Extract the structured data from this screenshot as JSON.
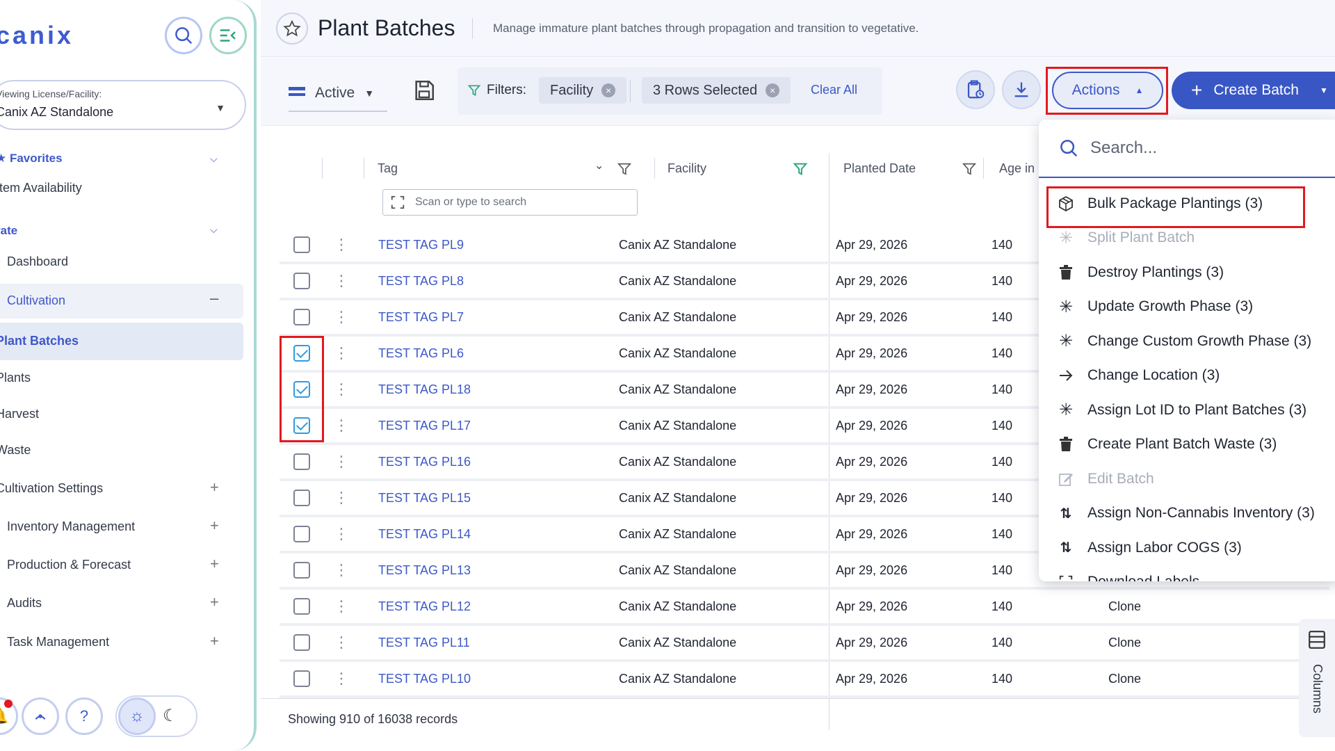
{
  "app": {
    "brand": "canix"
  },
  "sidebar": {
    "license_label": "Viewing License/Facility:",
    "license_value": "Canix AZ Standalone",
    "favorites_label": "Favorites",
    "item_availability": "Item Availability",
    "operate_label": "rate",
    "dashboard": "Dashboard",
    "cultivation": "Cultivation",
    "plant_batches": "Plant Batches",
    "plants": "Plants",
    "harvest": "Harvest",
    "waste": "Waste",
    "cultivation_settings": "Cultivation Settings",
    "inventory_management": "Inventory Management",
    "production_forecast": "Production & Forecast",
    "audits": "Audits",
    "task_management": "Task Management"
  },
  "header": {
    "title": "Plant Batches",
    "subtitle": "Manage immature plant batches through propagation and transition to vegetative."
  },
  "toolbar": {
    "status": "Active",
    "filters_label": "Filters:",
    "chip_facility": "Facility",
    "chip_rows": "3 Rows Selected",
    "clear_all": "Clear All",
    "actions": "Actions",
    "create_batch": "Create Batch"
  },
  "table": {
    "columns": {
      "tag": "Tag",
      "facility": "Facility",
      "planted_date": "Planted Date",
      "age": "Age in"
    },
    "tag_search_placeholder": "Scan or type to search",
    "rows": [
      {
        "tag": "TEST TAG PL9",
        "facility": "Canix AZ Standalone",
        "date": "Apr 29, 2026",
        "age": "140",
        "type": "",
        "checked": false
      },
      {
        "tag": "TEST TAG PL8",
        "facility": "Canix AZ Standalone",
        "date": "Apr 29, 2026",
        "age": "140",
        "type": "",
        "checked": false
      },
      {
        "tag": "TEST TAG PL7",
        "facility": "Canix AZ Standalone",
        "date": "Apr 29, 2026",
        "age": "140",
        "type": "",
        "checked": false
      },
      {
        "tag": "TEST TAG PL6",
        "facility": "Canix AZ Standalone",
        "date": "Apr 29, 2026",
        "age": "140",
        "type": "",
        "checked": true
      },
      {
        "tag": "TEST TAG PL18",
        "facility": "Canix AZ Standalone",
        "date": "Apr 29, 2026",
        "age": "140",
        "type": "",
        "checked": true
      },
      {
        "tag": "TEST TAG PL17",
        "facility": "Canix AZ Standalone",
        "date": "Apr 29, 2026",
        "age": "140",
        "type": "",
        "checked": true
      },
      {
        "tag": "TEST TAG PL16",
        "facility": "Canix AZ Standalone",
        "date": "Apr 29, 2026",
        "age": "140",
        "type": "",
        "checked": false
      },
      {
        "tag": "TEST TAG PL15",
        "facility": "Canix AZ Standalone",
        "date": "Apr 29, 2026",
        "age": "140",
        "type": "",
        "checked": false
      },
      {
        "tag": "TEST TAG PL14",
        "facility": "Canix AZ Standalone",
        "date": "Apr 29, 2026",
        "age": "140",
        "type": "",
        "checked": false
      },
      {
        "tag": "TEST TAG PL13",
        "facility": "Canix AZ Standalone",
        "date": "Apr 29, 2026",
        "age": "140",
        "type": "",
        "checked": false
      },
      {
        "tag": "TEST TAG PL12",
        "facility": "Canix AZ Standalone",
        "date": "Apr 29, 2026",
        "age": "140",
        "type": "Clone",
        "checked": false
      },
      {
        "tag": "TEST TAG PL11",
        "facility": "Canix AZ Standalone",
        "date": "Apr 29, 2026",
        "age": "140",
        "type": "Clone",
        "checked": false
      },
      {
        "tag": "TEST TAG PL10",
        "facility": "Canix AZ Standalone",
        "date": "Apr 29, 2026",
        "age": "140",
        "type": "Clone",
        "checked": false
      }
    ],
    "records": "Showing 910 of 16038 records",
    "columns_tab": "Columns"
  },
  "actions_menu": {
    "search_placeholder": "Search...",
    "items": [
      {
        "label": "Bulk Package Plantings (3)",
        "icon": "package-icon",
        "disabled": false
      },
      {
        "label": "Split Plant Batch",
        "icon": "leaf-icon",
        "disabled": true
      },
      {
        "label": "Destroy Plantings (3)",
        "icon": "trash-icon",
        "disabled": false
      },
      {
        "label": "Update Growth Phase (3)",
        "icon": "leaf-icon",
        "disabled": false
      },
      {
        "label": "Change Custom Growth Phase (3)",
        "icon": "leaf-icon",
        "disabled": false
      },
      {
        "label": "Change Location (3)",
        "icon": "arrow-right-icon",
        "disabled": false
      },
      {
        "label": "Assign Lot ID to Plant Batches (3)",
        "icon": "leaf-icon",
        "disabled": false
      },
      {
        "label": "Create Plant Batch Waste (3)",
        "icon": "trash-icon",
        "disabled": false
      },
      {
        "label": "Edit Batch",
        "icon": "edit-icon",
        "disabled": true
      },
      {
        "label": "Assign Non-Cannabis Inventory (3)",
        "icon": "swap-icon",
        "disabled": false
      },
      {
        "label": "Assign Labor COGS (3)",
        "icon": "swap-icon",
        "disabled": false
      },
      {
        "label": "Download Labels",
        "icon": "scan-icon",
        "disabled": false
      }
    ]
  },
  "colors": {
    "accent": "#3b58c8",
    "highlight_box": "#e2191f",
    "check": "#2f9be0"
  }
}
